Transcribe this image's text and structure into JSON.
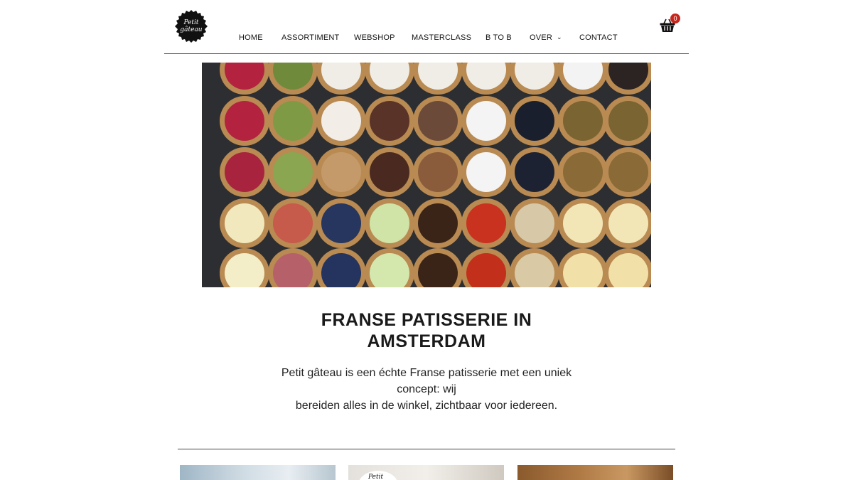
{
  "brand": {
    "logo_line1": "Petit",
    "logo_line2": "gâteau"
  },
  "nav": {
    "items": [
      {
        "label": "HOME"
      },
      {
        "label": "ASSORTIMENT"
      },
      {
        "label": "WEBSHOP"
      },
      {
        "label": "MASTERCLASS"
      },
      {
        "label": "B TO B"
      },
      {
        "label": "OVER",
        "has_dropdown": true
      },
      {
        "label": "CONTACT"
      }
    ]
  },
  "cart": {
    "count": "0",
    "icon": "basket-icon",
    "badge_color": "#c8261d"
  },
  "hero": {
    "subject": "tartlets"
  },
  "main": {
    "headline_line1": "FRANSE PATISSERIE IN",
    "headline_line2": "AMSTERDAM",
    "intro_line1": "Petit gâteau is een échte Franse patisserie met een uniek concept: wij",
    "intro_line2": "bereiden alles in de winkel, zichtbaar voor iedereen."
  },
  "thumbs": {
    "mini_logo_text": "Petit"
  }
}
